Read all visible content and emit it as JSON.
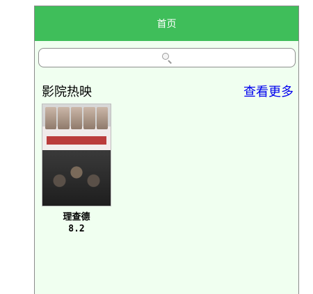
{
  "header": {
    "title": "首页"
  },
  "search": {
    "icon": "search-icon"
  },
  "section": {
    "title": "影院热映",
    "more_label": "查看更多"
  },
  "movies": [
    {
      "name": "理查德",
      "score": "8.2"
    }
  ],
  "colors": {
    "accent": "#3fbe5a",
    "background": "#f0fff0",
    "link": "#0000ee"
  }
}
